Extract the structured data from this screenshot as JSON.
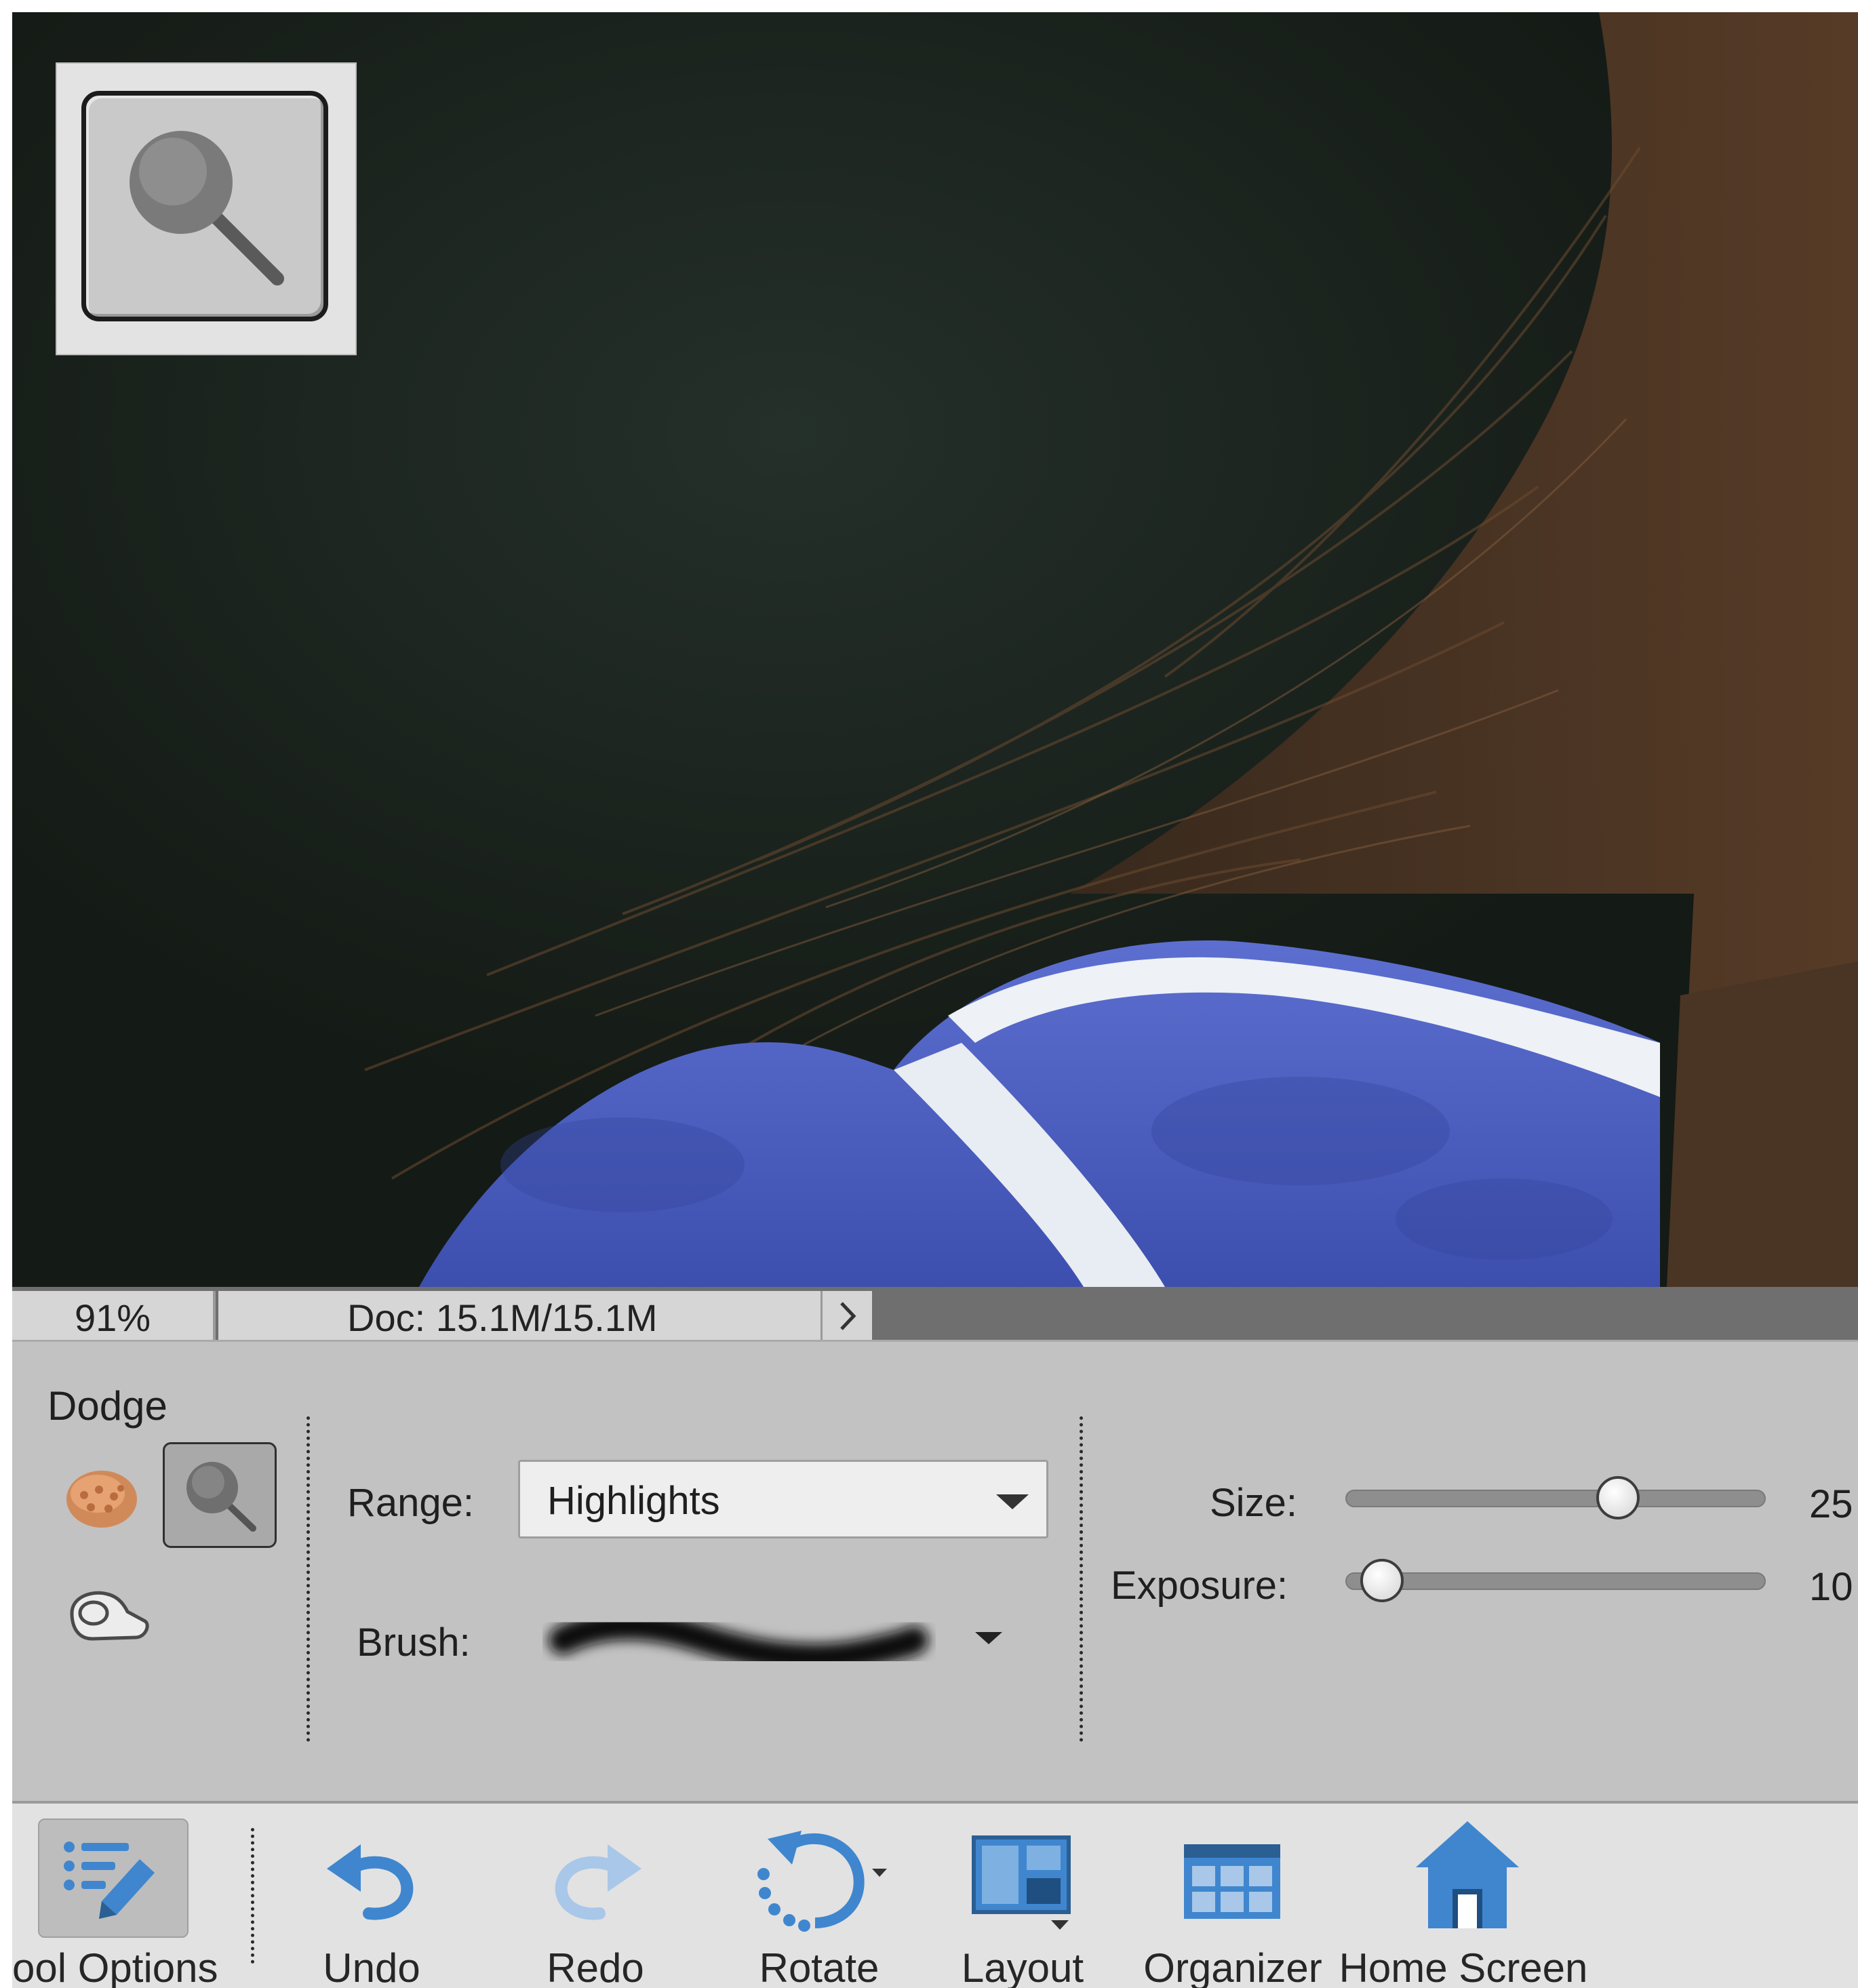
{
  "status": {
    "zoom": "91%",
    "doc_info": "Doc: 15.1M/15.1M"
  },
  "options_panel": {
    "tool_name": "Dodge",
    "range_label": "Range:",
    "range_value": "Highlights",
    "brush_label": "Brush:",
    "size_label": "Size:",
    "size_value": "25",
    "exposure_label": "Exposure:",
    "exposure_value": "10"
  },
  "taskbar": {
    "tool_options": "ool Options",
    "undo": "Undo",
    "redo": "Redo",
    "rotate": "Rotate",
    "layout": "Layout",
    "organizer": "Organizer",
    "home_screen": "Home Screen"
  },
  "icons": {
    "active_tool": "dodge-tool-icon",
    "variants": [
      "sponge-icon",
      "dodge-icon",
      "burn-icon"
    ],
    "taskbar": [
      "tool-options-icon",
      "undo-icon",
      "redo-icon",
      "rotate-icon",
      "layout-icon",
      "organizer-icon",
      "home-icon"
    ]
  },
  "colors": {
    "panel": "#c2c2c2",
    "taskbar": "#e2e2e2",
    "accent_blue": "#3f86cf"
  }
}
